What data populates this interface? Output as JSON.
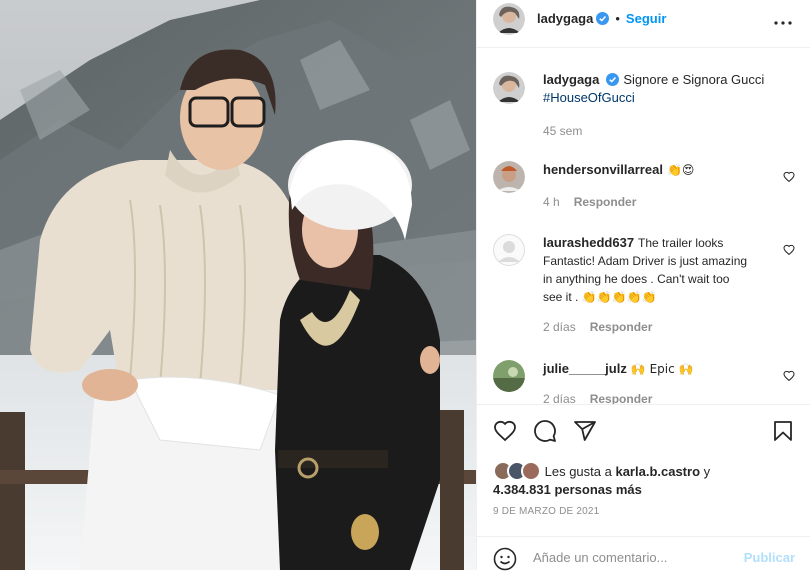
{
  "colors": {
    "accent": "#0095f6",
    "text": "#262626",
    "muted": "#8e8e8e",
    "hashtag": "#00376b",
    "publish_disabled": "#b2dffc",
    "divider": "#efefef"
  },
  "header": {
    "username": "ladygaga",
    "verified_icon": "verified-badge-icon",
    "separator": "•",
    "follow_label": "Seguir",
    "more_icon": "more-options-icon"
  },
  "caption": {
    "username": "ladygaga",
    "text": "Signore e Signora Gucci",
    "hashtag": "#HouseOfGucci",
    "time": "45 sem"
  },
  "comments": [
    {
      "username": "hendersonvillarreal",
      "text": "👏😍",
      "time": "4 h",
      "reply_label": "Responder"
    },
    {
      "username": "laurashedd637",
      "text": "The trailer looks Fantastic! Adam Driver is just amazing in anything he does . Can't wait too see it . 👏👏👏👏👏",
      "time": "2 días",
      "reply_label": "Responder"
    },
    {
      "username": "julie_____julz",
      "text": "🙌 Epic 🙌",
      "time": "2 días",
      "reply_label": "Responder"
    }
  ],
  "actions": {
    "like_icon": "heart-icon",
    "comment_icon": "comment-icon",
    "share_icon": "send-icon",
    "save_icon": "bookmark-icon"
  },
  "likes": {
    "prefix": "Les gusta a",
    "user": "karla.b.castro",
    "conjunction": "y",
    "count": "4.384.831 personas más"
  },
  "date": "9 DE MARZO DE 2021",
  "add_comment": {
    "emoji_icon": "emoji-icon",
    "placeholder": "Añade un comentario...",
    "publish_label": "Publicar"
  }
}
